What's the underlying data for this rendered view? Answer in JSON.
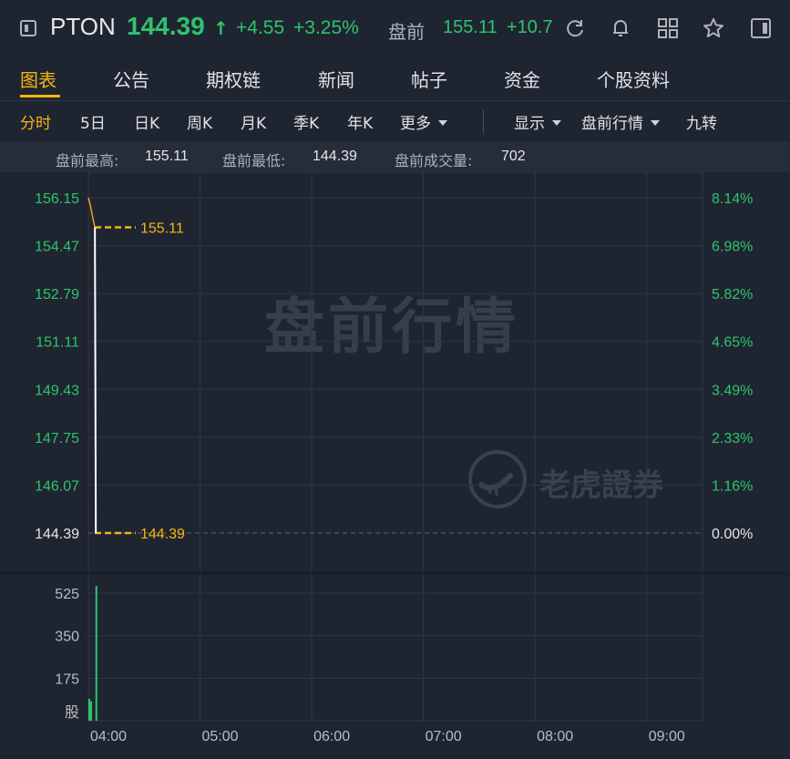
{
  "header": {
    "symbol": "PTON",
    "price": "144.39",
    "price_arrow": "↑",
    "change": "+4.55",
    "change_pct": "+3.25%",
    "premarket_label": "盘前",
    "premarket_price": "155.11",
    "premarket_change": "+10.72"
  },
  "tabs": [
    {
      "label": "图表",
      "active": true
    },
    {
      "label": "公告"
    },
    {
      "label": "期权链"
    },
    {
      "label": "新闻"
    },
    {
      "label": "帖子"
    },
    {
      "label": "资金"
    },
    {
      "label": "个股资料"
    }
  ],
  "periods": {
    "intraday": "分时",
    "five_day": "5日",
    "day_k": "日K",
    "week_k": "周K",
    "month_k": "月K",
    "quarter_k": "季K",
    "year_k": "年K",
    "more": "更多",
    "display": "显示",
    "premarket": "盘前行情",
    "nine_turn": "九转"
  },
  "info": {
    "high_label": "盘前最高:",
    "high_value": "155.11",
    "low_label": "盘前最低:",
    "low_value": "144.39",
    "volume_label": "盘前成交量:",
    "volume_value": "702"
  },
  "watermark": "盘前行情",
  "brand": "老虎證券",
  "colors": {
    "up": "#2dc46f",
    "accent": "#f5b515",
    "bg": "#1f2530",
    "grid": "#2f3744"
  },
  "chart_data": {
    "type": "line",
    "price_axis_labels": [
      "156.15",
      "154.47",
      "152.79",
      "151.11",
      "149.43",
      "147.75",
      "146.07",
      "144.39"
    ],
    "pct_axis_labels": [
      "8.14%",
      "6.98%",
      "5.82%",
      "4.65%",
      "3.49%",
      "2.33%",
      "1.16%",
      "0.00%"
    ],
    "ylim": [
      144.39,
      156.15
    ],
    "x_ticks": [
      "04:00",
      "05:00",
      "06:00",
      "07:00",
      "08:00",
      "09:00"
    ],
    "xlim_minutes": [
      0,
      330
    ],
    "price_series": [
      {
        "t": 0,
        "p": 156.15
      },
      {
        "t": 1,
        "p": 155.9
      },
      {
        "t": 2.5,
        "p": 155.4
      },
      {
        "t": 3.5,
        "p": 155.11
      },
      {
        "t": 4,
        "p": 144.39
      }
    ],
    "ref_lines": [
      {
        "label": "155.11",
        "value": 155.11
      },
      {
        "label": "144.39",
        "value": 144.39
      }
    ],
    "volume_axis_labels": [
      "525",
      "350",
      "175"
    ],
    "volume_unit": "股",
    "volume_max": 600,
    "volume_bars": [
      {
        "t": 0,
        "v": 90
      },
      {
        "t": 1,
        "v": 80
      },
      {
        "t": 3.8,
        "v": 555
      }
    ]
  }
}
